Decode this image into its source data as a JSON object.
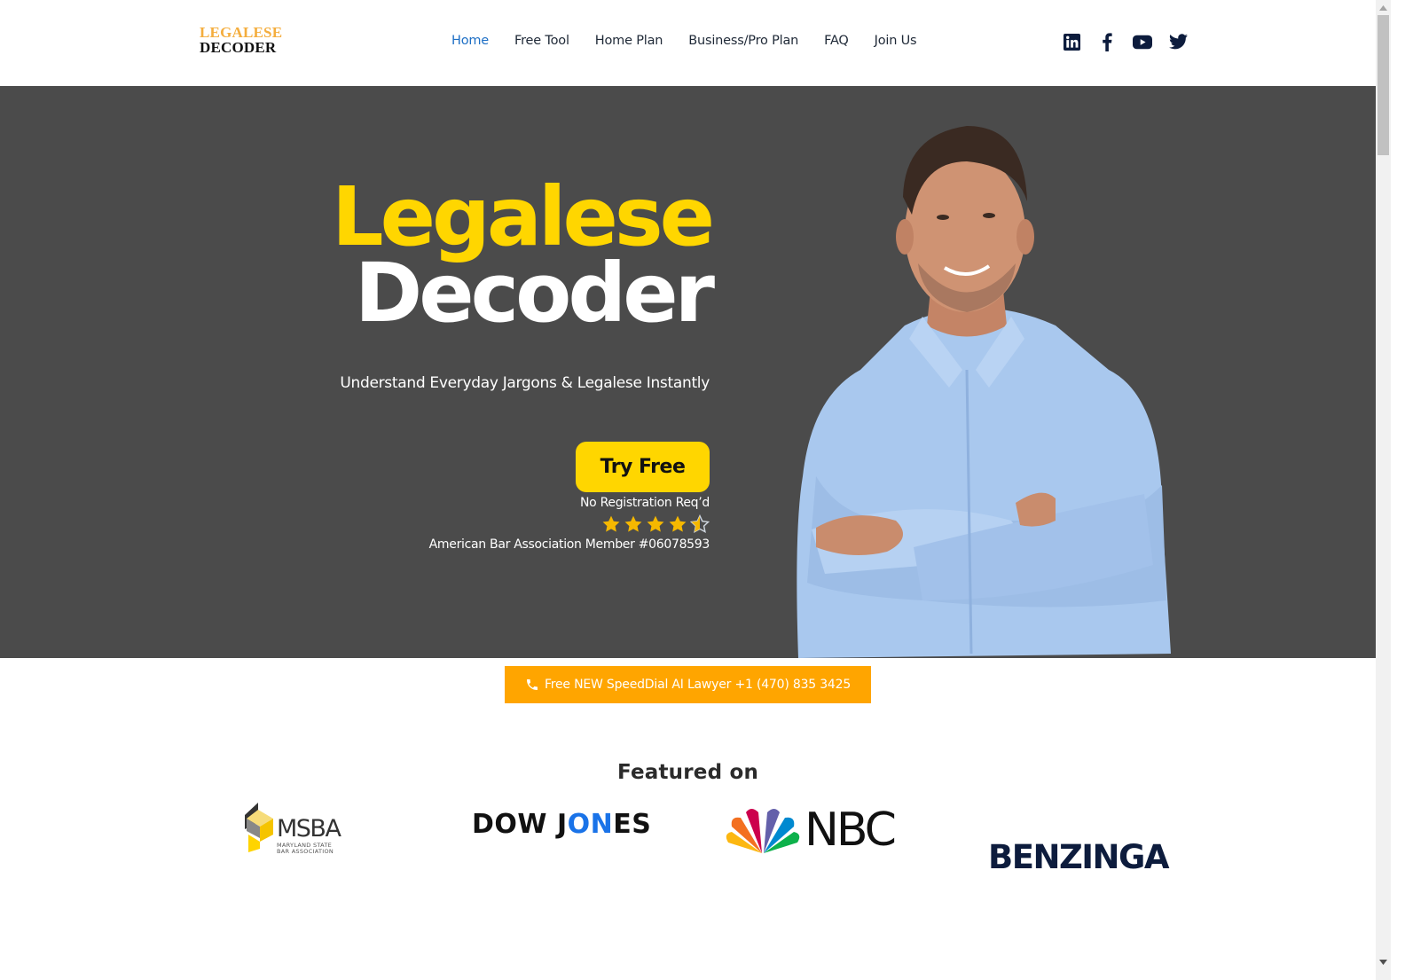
{
  "header": {
    "logo": {
      "line1": "LEGALESE",
      "line2": "DECODER"
    },
    "nav": [
      {
        "label": "Home",
        "active": true
      },
      {
        "label": "Free Tool",
        "active": false
      },
      {
        "label": "Home Plan",
        "active": false
      },
      {
        "label": "Business/Pro Plan",
        "active": false
      },
      {
        "label": "FAQ",
        "active": false
      },
      {
        "label": "Join Us",
        "active": false
      }
    ],
    "social": [
      "linkedin-icon",
      "facebook-icon",
      "youtube-icon",
      "twitter-icon"
    ]
  },
  "hero": {
    "title_line1": "Legalese",
    "title_line2": "Decoder",
    "subtitle": "Understand Everyday Jargons & Legalese Instantly",
    "cta_label": "Try Free",
    "cta_note": "No Registration Req’d",
    "rating": 4.5,
    "rating_max": 5,
    "membership": "American Bar Association Member #06078593",
    "image": "smiling-man-blue-shirt-arms-crossed"
  },
  "speed_dial": {
    "label": "Free NEW SpeedDial AI Lawyer +1 (470) 835 3425",
    "icon": "phone-icon"
  },
  "featured": {
    "heading": "Featured on",
    "logos": [
      {
        "name": "MSBA",
        "sub1": "MARYLAND STATE",
        "sub2": "BAR ASSOCIATION"
      },
      {
        "name_part1": "DOW J",
        "name_part2": "ON",
        "name_part3": "ES"
      },
      {
        "name": "NBC"
      },
      {
        "name": "BENZINGA"
      }
    ]
  },
  "colors": {
    "brand_yellow": "#ffd600",
    "logo_orange": "#f4ad3d",
    "speed_dial_orange": "#ffa500",
    "hero_bg": "#4b4b4b",
    "nav_active": "#1e6fc5",
    "star": "#f5b800"
  }
}
